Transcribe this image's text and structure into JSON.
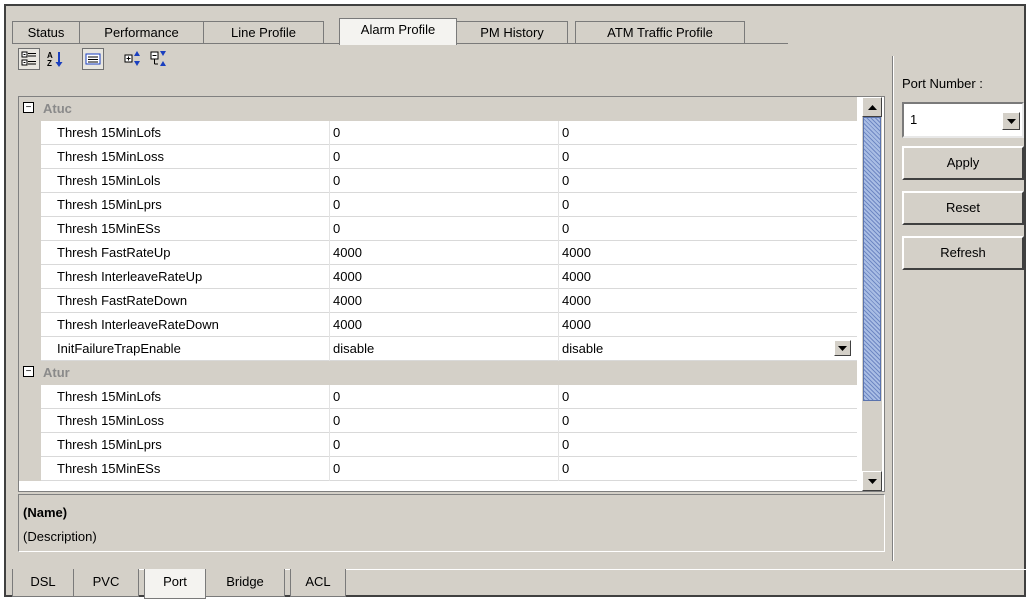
{
  "tabs": [
    {
      "label": "Status"
    },
    {
      "label": "Performance"
    },
    {
      "label": "Line Profile"
    },
    {
      "label": "Alarm Profile",
      "active": true
    },
    {
      "label": "PM History"
    },
    {
      "label": "ATM Traffic Profile"
    }
  ],
  "toolbar": {
    "icons": [
      "categorized-icon",
      "alphabetical-icon",
      "property-pages-icon",
      "expand-all-icon",
      "collapse-all-icon"
    ]
  },
  "grid": {
    "categories": [
      {
        "name": "Atuc",
        "expander": "−",
        "rows": [
          {
            "name": "Thresh 15MinLofs",
            "value1": "0",
            "value2": "0"
          },
          {
            "name": "Thresh 15MinLoss",
            "value1": "0",
            "value2": "0"
          },
          {
            "name": "Thresh 15MinLols",
            "value1": "0",
            "value2": "0"
          },
          {
            "name": "Thresh 15MinLprs",
            "value1": "0",
            "value2": "0"
          },
          {
            "name": "Thresh 15MinESs",
            "value1": "0",
            "value2": "0"
          },
          {
            "name": "Thresh FastRateUp",
            "value1": "4000",
            "value2": "4000"
          },
          {
            "name": "Thresh InterleaveRateUp",
            "value1": "4000",
            "value2": "4000"
          },
          {
            "name": "Thresh FastRateDown",
            "value1": "4000",
            "value2": "4000"
          },
          {
            "name": "Thresh InterleaveRateDown",
            "value1": "4000",
            "value2": "4000"
          },
          {
            "name": "InitFailureTrapEnable",
            "value1": "disable",
            "value2": "disable",
            "dropdown": true
          }
        ]
      },
      {
        "name": "Atur",
        "expander": "−",
        "rows": [
          {
            "name": "Thresh 15MinLofs",
            "value1": "0",
            "value2": "0"
          },
          {
            "name": "Thresh 15MinLoss",
            "value1": "0",
            "value2": "0"
          },
          {
            "name": "Thresh 15MinLprs",
            "value1": "0",
            "value2": "0"
          },
          {
            "name": "Thresh 15MinESs",
            "value1": "0",
            "value2": "0"
          }
        ]
      }
    ]
  },
  "description": {
    "name": "(Name)",
    "text": "(Description)"
  },
  "side": {
    "port_label": "Port Number :",
    "port_value": "1",
    "apply_label": "Apply",
    "reset_label": "Reset",
    "refresh_label": "Refresh"
  },
  "bottom_tabs": [
    {
      "label": "DSL"
    },
    {
      "label": "PVC"
    },
    {
      "label": "Port",
      "active": true
    },
    {
      "label": "Bridge"
    },
    {
      "label": "ACL"
    }
  ],
  "colors": {
    "panel": "#d4d0c8",
    "scroll_thumb": "#8aa2d0",
    "category_text": "#8a8a8a"
  }
}
